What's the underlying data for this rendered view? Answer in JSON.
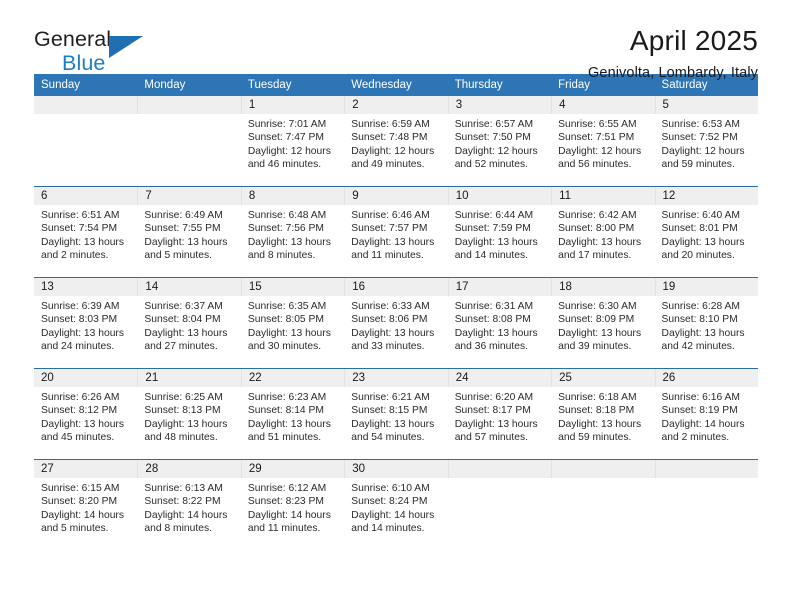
{
  "brand": {
    "name_primary": "General",
    "name_secondary": "Blue",
    "triangle_color": "#1f6fb2"
  },
  "header": {
    "title": "April 2025",
    "subtitle": "Genivolta, Lombardy, Italy"
  },
  "theme": {
    "header_blue": "#2e75b6",
    "row_divider": "#2e6da4",
    "date_band": "#efefef",
    "text": "#1a1a1a"
  },
  "labels": {
    "sunrise": "Sunrise:",
    "sunset": "Sunset:",
    "daylight": "Daylight:"
  },
  "weekdays": [
    "Sunday",
    "Monday",
    "Tuesday",
    "Wednesday",
    "Thursday",
    "Friday",
    "Saturday"
  ],
  "weeks": [
    [
      {
        "day": "",
        "sunrise": "",
        "sunset": "",
        "daylight_line1": "",
        "daylight_line2": ""
      },
      {
        "day": "",
        "sunrise": "",
        "sunset": "",
        "daylight_line1": "",
        "daylight_line2": ""
      },
      {
        "day": "1",
        "sunrise": "Sunrise: 7:01 AM",
        "sunset": "Sunset: 7:47 PM",
        "daylight_line1": "Daylight: 12 hours",
        "daylight_line2": "and 46 minutes."
      },
      {
        "day": "2",
        "sunrise": "Sunrise: 6:59 AM",
        "sunset": "Sunset: 7:48 PM",
        "daylight_line1": "Daylight: 12 hours",
        "daylight_line2": "and 49 minutes."
      },
      {
        "day": "3",
        "sunrise": "Sunrise: 6:57 AM",
        "sunset": "Sunset: 7:50 PM",
        "daylight_line1": "Daylight: 12 hours",
        "daylight_line2": "and 52 minutes."
      },
      {
        "day": "4",
        "sunrise": "Sunrise: 6:55 AM",
        "sunset": "Sunset: 7:51 PM",
        "daylight_line1": "Daylight: 12 hours",
        "daylight_line2": "and 56 minutes."
      },
      {
        "day": "5",
        "sunrise": "Sunrise: 6:53 AM",
        "sunset": "Sunset: 7:52 PM",
        "daylight_line1": "Daylight: 12 hours",
        "daylight_line2": "and 59 minutes."
      }
    ],
    [
      {
        "day": "6",
        "sunrise": "Sunrise: 6:51 AM",
        "sunset": "Sunset: 7:54 PM",
        "daylight_line1": "Daylight: 13 hours",
        "daylight_line2": "and 2 minutes."
      },
      {
        "day": "7",
        "sunrise": "Sunrise: 6:49 AM",
        "sunset": "Sunset: 7:55 PM",
        "daylight_line1": "Daylight: 13 hours",
        "daylight_line2": "and 5 minutes."
      },
      {
        "day": "8",
        "sunrise": "Sunrise: 6:48 AM",
        "sunset": "Sunset: 7:56 PM",
        "daylight_line1": "Daylight: 13 hours",
        "daylight_line2": "and 8 minutes."
      },
      {
        "day": "9",
        "sunrise": "Sunrise: 6:46 AM",
        "sunset": "Sunset: 7:57 PM",
        "daylight_line1": "Daylight: 13 hours",
        "daylight_line2": "and 11 minutes."
      },
      {
        "day": "10",
        "sunrise": "Sunrise: 6:44 AM",
        "sunset": "Sunset: 7:59 PM",
        "daylight_line1": "Daylight: 13 hours",
        "daylight_line2": "and 14 minutes."
      },
      {
        "day": "11",
        "sunrise": "Sunrise: 6:42 AM",
        "sunset": "Sunset: 8:00 PM",
        "daylight_line1": "Daylight: 13 hours",
        "daylight_line2": "and 17 minutes."
      },
      {
        "day": "12",
        "sunrise": "Sunrise: 6:40 AM",
        "sunset": "Sunset: 8:01 PM",
        "daylight_line1": "Daylight: 13 hours",
        "daylight_line2": "and 20 minutes."
      }
    ],
    [
      {
        "day": "13",
        "sunrise": "Sunrise: 6:39 AM",
        "sunset": "Sunset: 8:03 PM",
        "daylight_line1": "Daylight: 13 hours",
        "daylight_line2": "and 24 minutes."
      },
      {
        "day": "14",
        "sunrise": "Sunrise: 6:37 AM",
        "sunset": "Sunset: 8:04 PM",
        "daylight_line1": "Daylight: 13 hours",
        "daylight_line2": "and 27 minutes."
      },
      {
        "day": "15",
        "sunrise": "Sunrise: 6:35 AM",
        "sunset": "Sunset: 8:05 PM",
        "daylight_line1": "Daylight: 13 hours",
        "daylight_line2": "and 30 minutes."
      },
      {
        "day": "16",
        "sunrise": "Sunrise: 6:33 AM",
        "sunset": "Sunset: 8:06 PM",
        "daylight_line1": "Daylight: 13 hours",
        "daylight_line2": "and 33 minutes."
      },
      {
        "day": "17",
        "sunrise": "Sunrise: 6:31 AM",
        "sunset": "Sunset: 8:08 PM",
        "daylight_line1": "Daylight: 13 hours",
        "daylight_line2": "and 36 minutes."
      },
      {
        "day": "18",
        "sunrise": "Sunrise: 6:30 AM",
        "sunset": "Sunset: 8:09 PM",
        "daylight_line1": "Daylight: 13 hours",
        "daylight_line2": "and 39 minutes."
      },
      {
        "day": "19",
        "sunrise": "Sunrise: 6:28 AM",
        "sunset": "Sunset: 8:10 PM",
        "daylight_line1": "Daylight: 13 hours",
        "daylight_line2": "and 42 minutes."
      }
    ],
    [
      {
        "day": "20",
        "sunrise": "Sunrise: 6:26 AM",
        "sunset": "Sunset: 8:12 PM",
        "daylight_line1": "Daylight: 13 hours",
        "daylight_line2": "and 45 minutes."
      },
      {
        "day": "21",
        "sunrise": "Sunrise: 6:25 AM",
        "sunset": "Sunset: 8:13 PM",
        "daylight_line1": "Daylight: 13 hours",
        "daylight_line2": "and 48 minutes."
      },
      {
        "day": "22",
        "sunrise": "Sunrise: 6:23 AM",
        "sunset": "Sunset: 8:14 PM",
        "daylight_line1": "Daylight: 13 hours",
        "daylight_line2": "and 51 minutes."
      },
      {
        "day": "23",
        "sunrise": "Sunrise: 6:21 AM",
        "sunset": "Sunset: 8:15 PM",
        "daylight_line1": "Daylight: 13 hours",
        "daylight_line2": "and 54 minutes."
      },
      {
        "day": "24",
        "sunrise": "Sunrise: 6:20 AM",
        "sunset": "Sunset: 8:17 PM",
        "daylight_line1": "Daylight: 13 hours",
        "daylight_line2": "and 57 minutes."
      },
      {
        "day": "25",
        "sunrise": "Sunrise: 6:18 AM",
        "sunset": "Sunset: 8:18 PM",
        "daylight_line1": "Daylight: 13 hours",
        "daylight_line2": "and 59 minutes."
      },
      {
        "day": "26",
        "sunrise": "Sunrise: 6:16 AM",
        "sunset": "Sunset: 8:19 PM",
        "daylight_line1": "Daylight: 14 hours",
        "daylight_line2": "and 2 minutes."
      }
    ],
    [
      {
        "day": "27",
        "sunrise": "Sunrise: 6:15 AM",
        "sunset": "Sunset: 8:20 PM",
        "daylight_line1": "Daylight: 14 hours",
        "daylight_line2": "and 5 minutes."
      },
      {
        "day": "28",
        "sunrise": "Sunrise: 6:13 AM",
        "sunset": "Sunset: 8:22 PM",
        "daylight_line1": "Daylight: 14 hours",
        "daylight_line2": "and 8 minutes."
      },
      {
        "day": "29",
        "sunrise": "Sunrise: 6:12 AM",
        "sunset": "Sunset: 8:23 PM",
        "daylight_line1": "Daylight: 14 hours",
        "daylight_line2": "and 11 minutes."
      },
      {
        "day": "30",
        "sunrise": "Sunrise: 6:10 AM",
        "sunset": "Sunset: 8:24 PM",
        "daylight_line1": "Daylight: 14 hours",
        "daylight_line2": "and 14 minutes."
      },
      {
        "day": "",
        "sunrise": "",
        "sunset": "",
        "daylight_line1": "",
        "daylight_line2": ""
      },
      {
        "day": "",
        "sunrise": "",
        "sunset": "",
        "daylight_line1": "",
        "daylight_line2": ""
      },
      {
        "day": "",
        "sunrise": "",
        "sunset": "",
        "daylight_line1": "",
        "daylight_line2": ""
      }
    ]
  ]
}
